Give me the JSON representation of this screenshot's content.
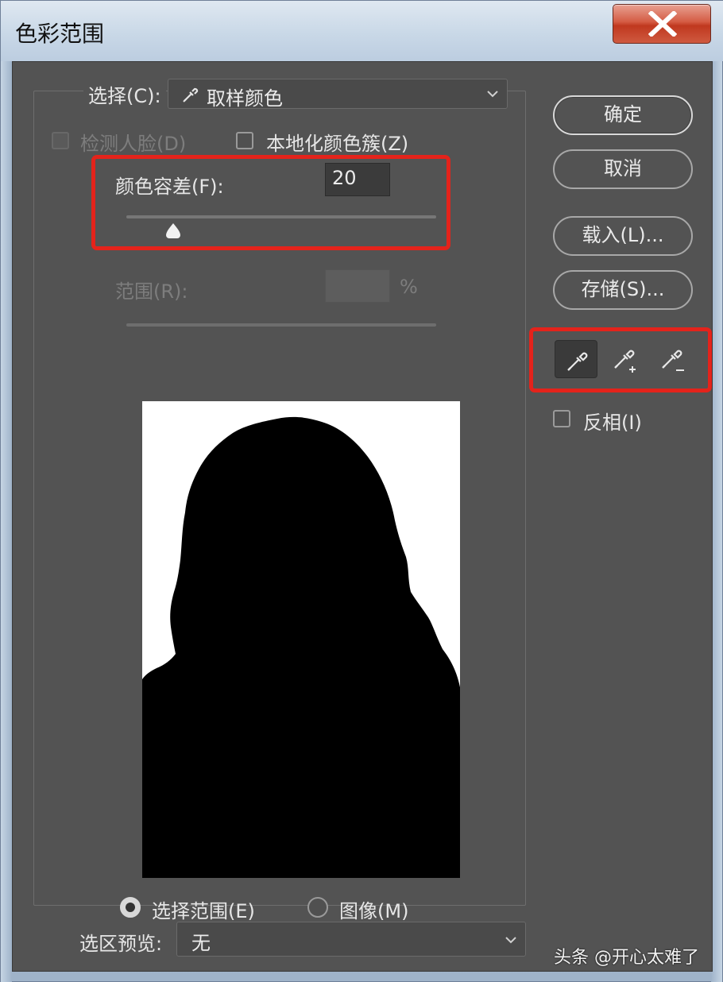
{
  "window": {
    "title": "色彩范围"
  },
  "select_row": {
    "label": "选择(C):",
    "value": "取样颜色"
  },
  "detect_faces": {
    "label": "检测人脸(D)"
  },
  "localized_clusters": {
    "label": "本地化颜色簇(Z)"
  },
  "fuzziness": {
    "label": "颜色容差(F):",
    "value": "20",
    "level_percent": 20
  },
  "range": {
    "label": "范围(R):",
    "value": "",
    "unit": "%"
  },
  "preview_mode": {
    "selection_label": "选择范围(E)",
    "image_label": "图像(M)",
    "selected": "selection"
  },
  "selection_preview": {
    "label": "选区预览:",
    "value": "无"
  },
  "buttons": {
    "ok": "确定",
    "cancel": "取消",
    "load": "载入(L)...",
    "save": "存储(S)..."
  },
  "eyedroppers": [
    "eyedropper-icon",
    "eyedropper-plus-icon",
    "eyedropper-minus-icon"
  ],
  "invert": {
    "label": "反相(I)"
  },
  "watermark": "头条 @开心太难了",
  "colors": {
    "dialog_bg": "#535353",
    "highlight": "#e4231b",
    "close_button": "#c7432a"
  }
}
